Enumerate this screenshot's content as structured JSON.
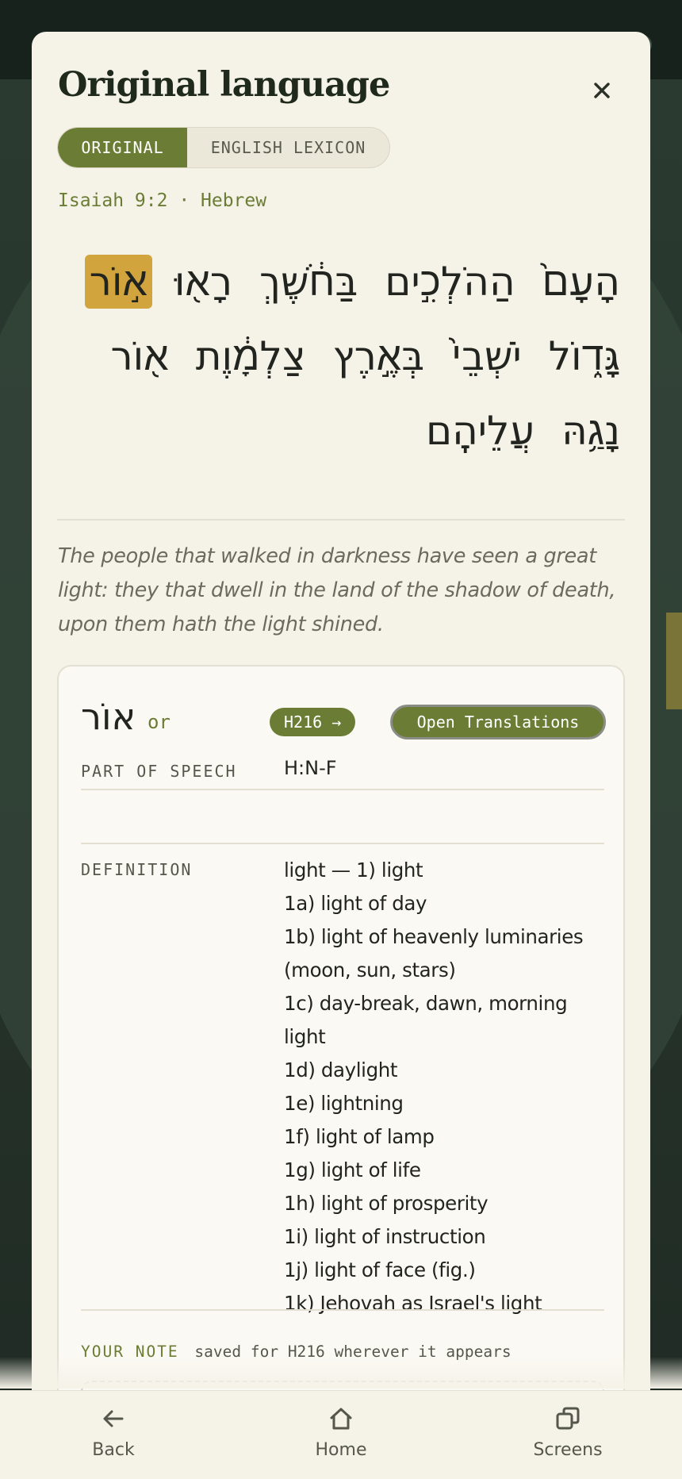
{
  "sheet": {
    "title": "Original language",
    "close_icon": "close-icon",
    "tabs": [
      {
        "label": "ORIGINAL",
        "active": true
      },
      {
        "label": "ENGLISH LEXICON",
        "active": false
      }
    ],
    "reference": "Isaiah 9:2 · Hebrew"
  },
  "hebrew_lines": [
    {
      "words": [
        "הָעָם֙",
        "הַהֹלְכִ֣ים",
        "בַּחֹ֔שֶׁךְ",
        "רָא֖וּ",
        "א֣וֹר"
      ]
    },
    {
      "words": [
        "גָּד֑וֹל",
        "יֹשְׁבֵי֙",
        "בְּאֶ֣רֶץ",
        "צַלְמָ֔וֶת",
        "א֖וֹר"
      ]
    },
    {
      "words": [
        "נָגַ֥הּ",
        "עֲלֵיהֶֽם"
      ]
    }
  ],
  "highlighted_word": "א֣וֹר",
  "translation": "The people that walked in darkness have seen a great light: they that dwell in the land of the shadow of death, upon them hath the light shined.",
  "lexicon": {
    "lemma": "אוֹר",
    "transliteration": "or",
    "strongs_label": "H216 →",
    "open_translations_label": "Open Translations",
    "part_of_speech_label": "PART OF SPEECH",
    "part_of_speech": "H:N-F",
    "definition_label": "DEFINITION",
    "definitions": [
      "light — 1) light",
      "1a) light of day",
      "1b) light of heavenly luminaries (moon, sun, stars)",
      "1c) day-break, dawn, morning light",
      "1d) daylight",
      "1e) lightning",
      "1f) light of lamp",
      "1g) light of life",
      "1h) light of prosperity",
      "1i) light of instruction",
      "1j) light of face (fig.)",
      "1k) Jehovah as Israel's light"
    ],
    "note_label": "YOUR NOTE",
    "note_hint": "saved for H216 wherever it appears"
  },
  "bottom_nav": [
    {
      "label": "Back",
      "icon": "arrow-left-icon"
    },
    {
      "label": "Home",
      "icon": "home-icon"
    },
    {
      "label": "Screens",
      "icon": "screens-icon"
    }
  ],
  "colors": {
    "accent": "#6b7d35",
    "highlight": "#d1a43e",
    "sheet_bg": "#f5f2e8",
    "text": "#22251f"
  }
}
